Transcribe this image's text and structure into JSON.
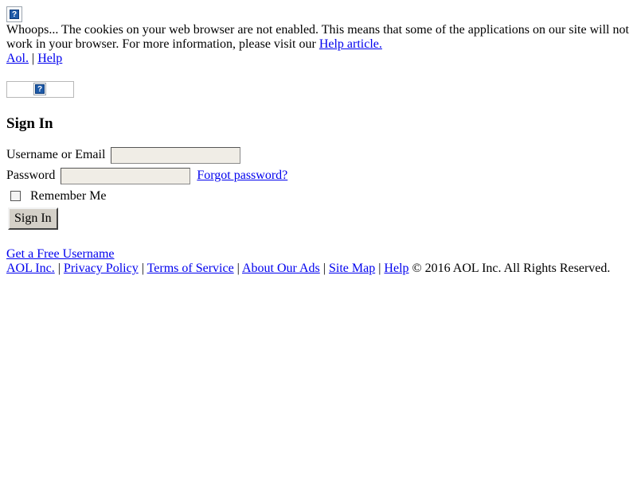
{
  "notice": {
    "text": "Whoops... The cookies on your web browser are not enabled. This means that some of the applications on our site will not work in your browser. For more information, please visit our",
    "help_link": "Help article."
  },
  "top_links": {
    "aol": "Aol.",
    "separator": "|",
    "help": "Help"
  },
  "signin": {
    "title": "Sign In",
    "username_label": "Username or Email",
    "username_value": "",
    "password_label": "Password",
    "password_value": "",
    "forgot_link": "Forgot password?",
    "remember_label": "Remember Me",
    "remember_checked": false,
    "submit_label": "Sign In"
  },
  "free_username_link": "Get a Free Username",
  "footer": {
    "links": [
      "AOL Inc.",
      "Privacy Policy",
      "Terms of Service",
      "About Our Ads",
      "Site Map",
      "Help"
    ],
    "separator": "|",
    "copyright": "© 2016 AOL Inc. All Rights Reserved."
  },
  "icons": {
    "broken_image_1": "broken-image-icon",
    "broken_image_2": "broken-image-icon"
  }
}
